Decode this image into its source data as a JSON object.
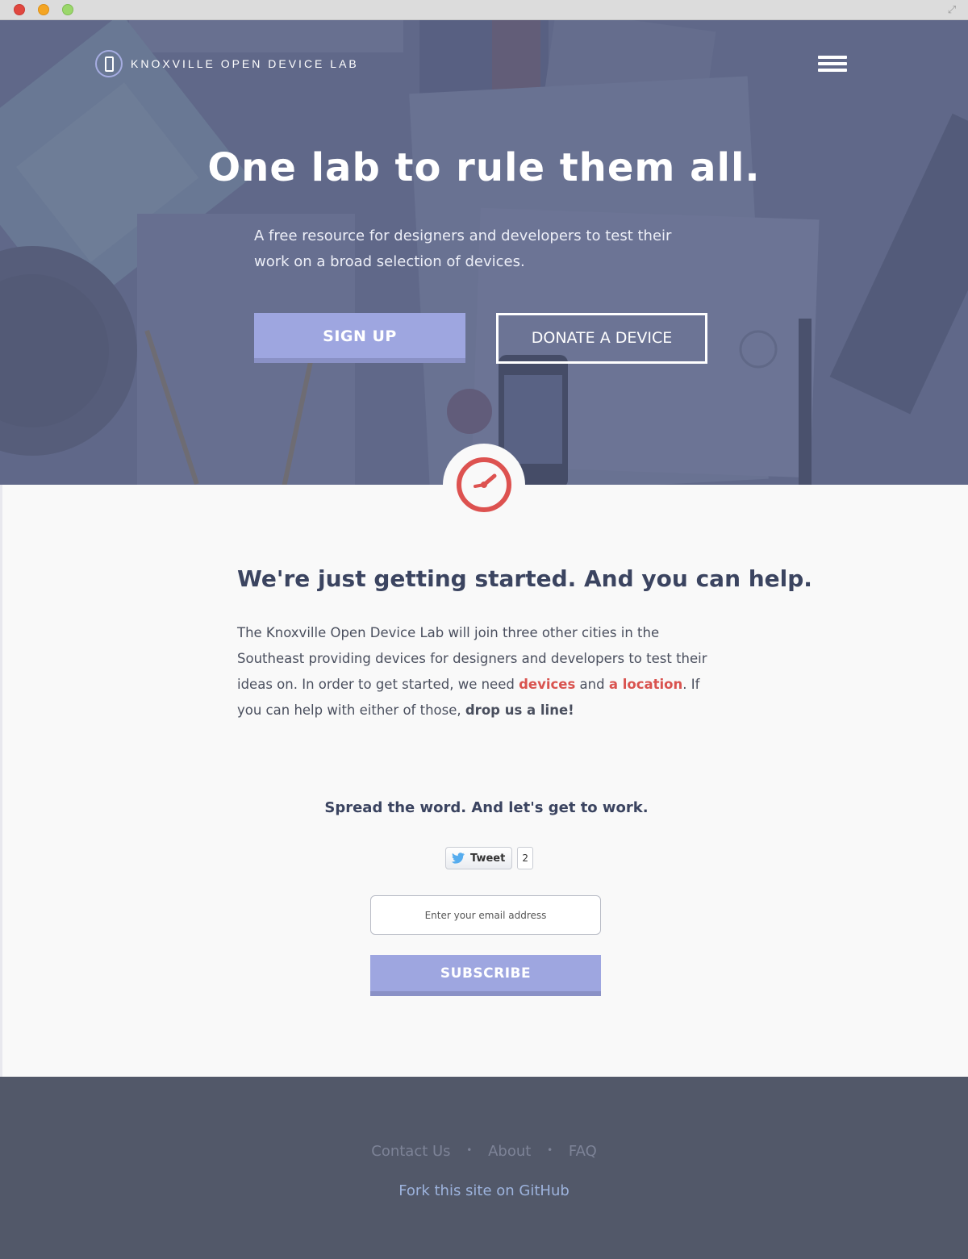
{
  "window": {
    "fullscreen_icon": "expand-arrows-icon"
  },
  "header": {
    "logo_text": "KNOXVILLE OPEN DEVICE LAB",
    "logo_icon": "phone-icon",
    "menu_icon": "hamburger-menu-icon"
  },
  "hero": {
    "title": "One lab to rule them all.",
    "subtitle": "A free resource for designers and developers to test their work on a broad selection of devices.",
    "signup_label": "SIGN UP",
    "donate_label": "DONATE A DEVICE"
  },
  "badge": {
    "icon": "clock-icon"
  },
  "main": {
    "title": "We're just getting started. And you can help.",
    "para_1": "The Knoxville Open Device Lab will join three other cities in the Southeast providing devices for designers and developers to test their ideas on. In order to get started, we need ",
    "link_devices": "devices",
    "para_2": " and ",
    "link_location": "a location",
    "para_3": ". If you can help with either of those, ",
    "cta_strong": "drop us a line!",
    "spread_title": "Spread the word. And let's get to work.",
    "tweet_label": "Tweet",
    "tweet_count": "2",
    "email_placeholder": "Enter your email address",
    "subscribe_label": "SUBSCRIBE"
  },
  "footer": {
    "links": [
      "Contact Us",
      "About",
      "FAQ"
    ],
    "separator": "•",
    "github_label": "Fork this site on GitHub"
  },
  "colors": {
    "accent_button": "#9ea6e0",
    "link_red": "#d9534f",
    "heading": "#3b4460",
    "footer_bg": "#525869"
  }
}
